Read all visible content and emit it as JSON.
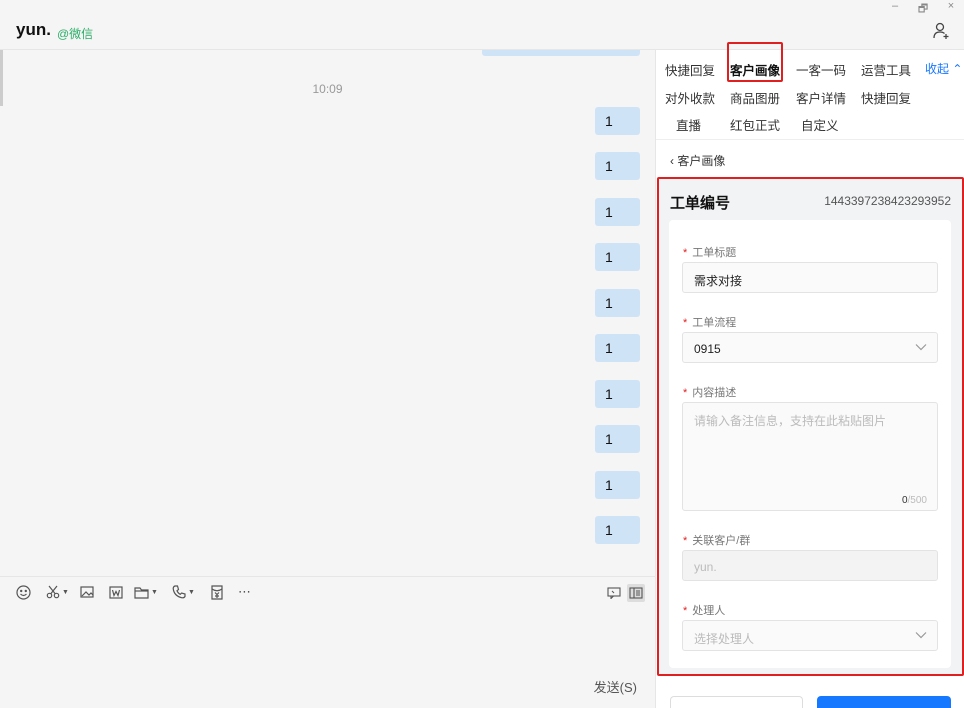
{
  "window": {
    "minimize": "–",
    "restore": "🗗",
    "close": "×"
  },
  "header": {
    "chat_name": "yun.",
    "chat_tag": "@微信"
  },
  "chat": {
    "time": "10:09",
    "messages": [
      "1",
      "1",
      "1",
      "1",
      "1",
      "1",
      "1",
      "1",
      "1",
      "1"
    ]
  },
  "composer": {
    "send_label": "发送(S)"
  },
  "sidebar": {
    "tabs_row1": [
      "快捷回复",
      "客户画像",
      "一客一码",
      "运营工具"
    ],
    "tabs_row2": [
      "对外收款",
      "商品图册",
      "客户详情",
      "快捷回复"
    ],
    "tabs_row3": [
      "直播",
      "红包正式",
      "自定义"
    ],
    "collapse_label": "收起 ⌃",
    "active_tab": "客户画像",
    "back_label": "客户画像",
    "ticket": {
      "title": "工单编号",
      "number": "1443397238423293952",
      "fields": {
        "subject_label": "工单标题",
        "subject_value": "需求对接",
        "flow_label": "工单流程",
        "flow_value": "0915",
        "desc_label": "内容描述",
        "desc_placeholder": "请输入备注信息，支持在此粘贴图片",
        "desc_count": "0",
        "desc_max": "/500",
        "customer_label": "关联客户/群",
        "customer_value": "yun.",
        "handler_label": "处理人",
        "handler_placeholder": "选择处理人"
      }
    }
  },
  "colors": {
    "accent": "#1677ff",
    "highlight": "#e02020",
    "bubble": "#cfe3f7",
    "wechat_green": "#2aae67"
  }
}
